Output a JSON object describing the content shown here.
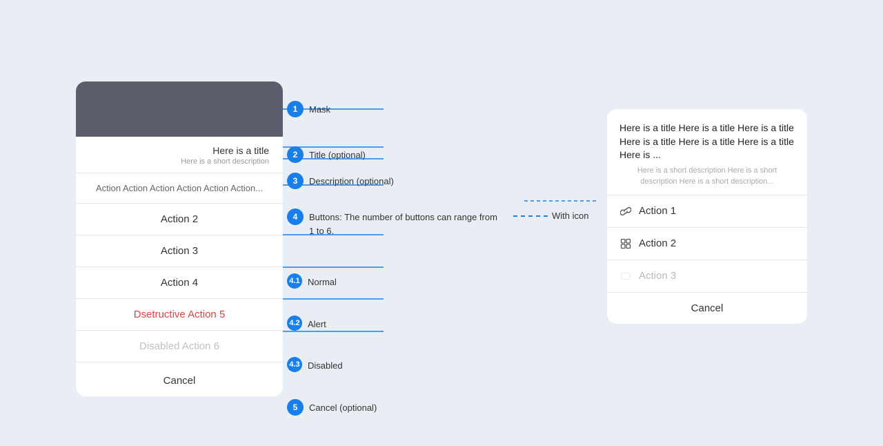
{
  "actionSheet": {
    "maskAlt": "Mask",
    "title": "Here is a title",
    "description": "Here is a short description",
    "items": [
      {
        "label": "Action Action Action Action Action Action...",
        "type": "overflow"
      },
      {
        "label": "Action 2",
        "type": "normal"
      },
      {
        "label": "Action 3",
        "type": "normal"
      },
      {
        "label": "Action 4",
        "type": "normal"
      },
      {
        "label": "Dsetructive Action 5",
        "type": "destructive"
      },
      {
        "label": "Disabled Action 6",
        "type": "disabled"
      }
    ],
    "cancel": "Cancel"
  },
  "detailPanel": {
    "title": "Here is a title Here is a title Here is a title Here is a title Here is a title Here is a title Here is ...",
    "description": "Here is a short description Here is a short description Here is a short description...",
    "items": [
      {
        "label": "Action 1",
        "icon": "link",
        "type": "normal"
      },
      {
        "label": "Action 2",
        "icon": "grid",
        "type": "normal"
      },
      {
        "label": "Action 3",
        "icon": "rect",
        "type": "disabled"
      }
    ],
    "cancel": "Cancel"
  },
  "annotations": {
    "1": {
      "badge": "1",
      "label": "Mask"
    },
    "2": {
      "badge": "2",
      "label": "Title (optional)"
    },
    "3": {
      "badge": "3",
      "label": "Description (optional)"
    },
    "4": {
      "badge": "4",
      "label": "Buttons: The number of buttons can range from 1 to 6.",
      "withIcon": "With icon",
      "sub": [
        {
          "badge": "4.1",
          "label": "Normal"
        },
        {
          "badge": "4.2",
          "label": "Alert"
        },
        {
          "badge": "4.3",
          "label": "Disabled"
        }
      ]
    },
    "5": {
      "badge": "5",
      "label": "Cancel (optional)"
    }
  },
  "colors": {
    "accent": "#1a7fe8",
    "destructive": "#e63e3e",
    "disabled": "#c0c0c0"
  }
}
